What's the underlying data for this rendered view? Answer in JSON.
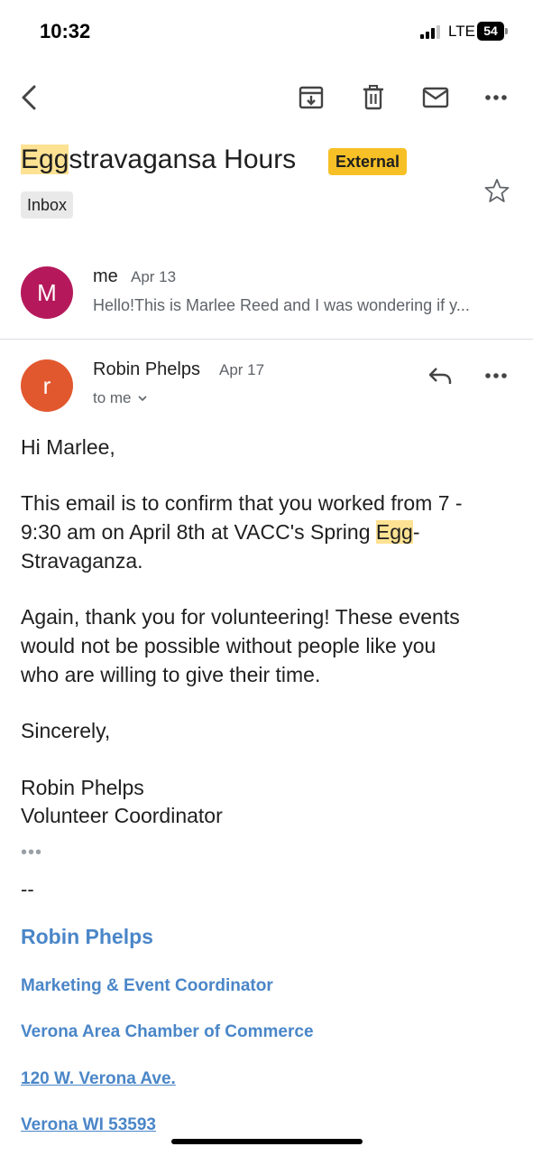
{
  "status_bar": {
    "time": "10:32",
    "network": "LTE",
    "battery": "54"
  },
  "toolbar": {
    "back_icon": "chevron-left-icon",
    "archive_icon": "archive-icon",
    "delete_icon": "trash-icon",
    "mark_unread_icon": "mail-icon",
    "more_icon": "more-horizontal-icon"
  },
  "subject": {
    "highlight": "Egg",
    "rest": "stravagansa Hours",
    "external_label": "External",
    "label_chip": "Inbox"
  },
  "messages": [
    {
      "avatar_letter": "M",
      "avatar_color": "#b5195b",
      "sender": "me",
      "date": "Apr 13",
      "snippet": "Hello!This is Marlee Reed and I was wondering if y..."
    },
    {
      "avatar_letter": "r",
      "avatar_color": "#e2582e",
      "sender": "Robin Phelps",
      "date": "Apr 17",
      "recipient": "to me"
    }
  ],
  "body": {
    "greeting": "Hi Marlee,",
    "p1_line1": "This email is to confirm that you worked from 7 -",
    "p1_line2_a": "9:30 am on April 8th at VACC's Spring ",
    "p1_line2_hl": "Egg",
    "p1_line2_b": "-",
    "p1_line3": "Stravaganza.",
    "p2_line1": "Again, thank you for volunteering! These events",
    "p2_line2": "would not be possible without people like you",
    "p2_line3": "who are willing to give their time.",
    "closing": "Sincerely,",
    "sign_name": "Robin Phelps",
    "sign_title": "Volunteer Coordinator",
    "trimmed": "•••"
  },
  "signature": {
    "dash": "--",
    "name": "Robin Phelps",
    "title": "Marketing & Event Coordinator",
    "org": "Verona Area Chamber of Commerce",
    "address1": "120 W. Verona Ave.",
    "address2": "Verona WI 53593"
  }
}
